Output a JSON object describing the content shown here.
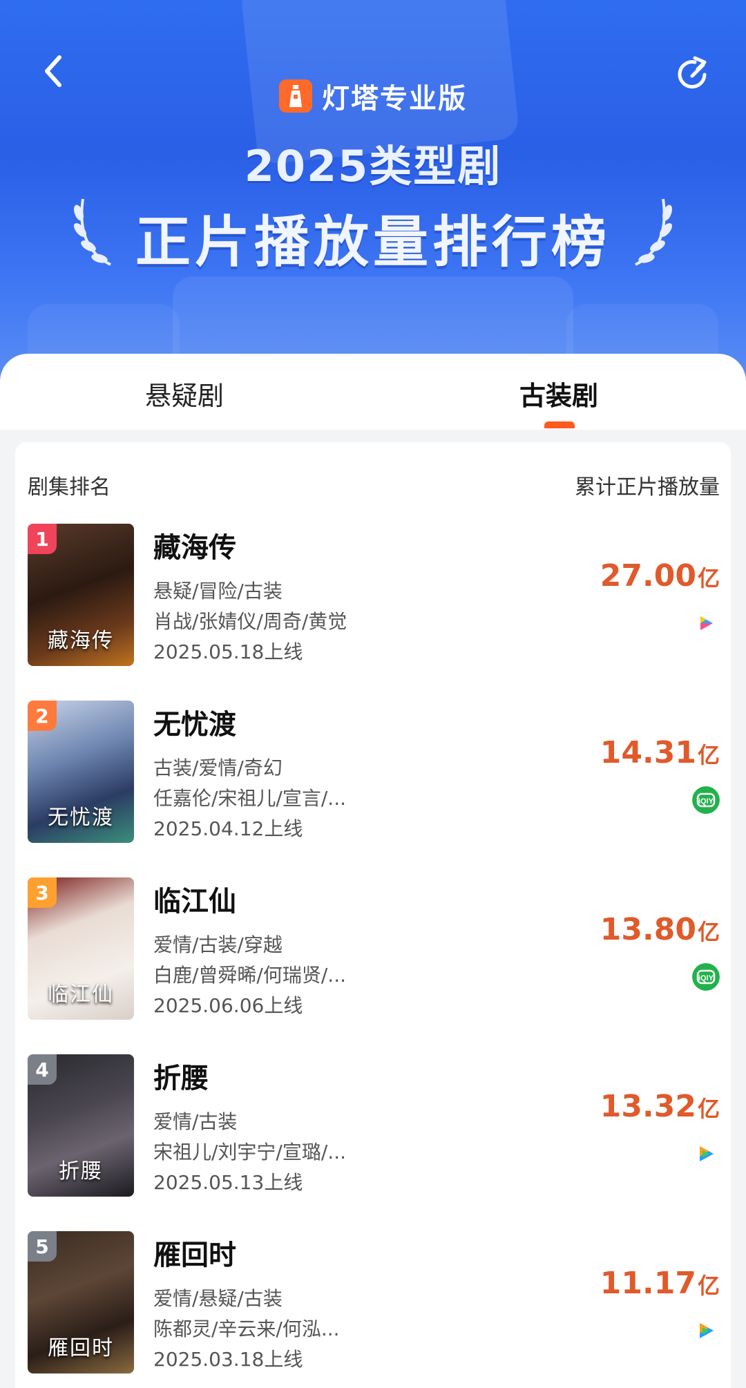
{
  "header": {
    "brand_name": "灯塔专业版",
    "title_line1": "2025类型剧",
    "title_line2": "正片播放量排行榜"
  },
  "tabs": [
    {
      "label": "悬疑剧",
      "active": false
    },
    {
      "label": "古装剧",
      "active": true
    }
  ],
  "list": {
    "col_left": "剧集排名",
    "col_right": "累计正片播放量",
    "items": [
      {
        "rank": "1",
        "title": "藏海传",
        "genre": "悬疑/冒险/古装",
        "cast": "肖战/张婧仪/周奇/黄觉",
        "date": "2025.05.18上线",
        "value": "27.00",
        "unit": "亿",
        "platform": "youku-icon",
        "poster_text": "藏海传"
      },
      {
        "rank": "2",
        "title": "无忧渡",
        "genre": "古装/爱情/奇幻",
        "cast": "任嘉伦/宋祖儿/宣言/...",
        "date": "2025.04.12上线",
        "value": "14.31",
        "unit": "亿",
        "platform": "iqiyi-icon",
        "poster_text": "无忧渡"
      },
      {
        "rank": "3",
        "title": "临江仙",
        "genre": "爱情/古装/穿越",
        "cast": "白鹿/曾舜晞/何瑞贤/...",
        "date": "2025.06.06上线",
        "value": "13.80",
        "unit": "亿",
        "platform": "iqiyi-icon",
        "poster_text": "临江仙"
      },
      {
        "rank": "4",
        "title": "折腰",
        "genre": "爱情/古装",
        "cast": "宋祖儿/刘宇宁/宣璐/...",
        "date": "2025.05.13上线",
        "value": "13.32",
        "unit": "亿",
        "platform": "tencent-video-icon",
        "poster_text": "折腰"
      },
      {
        "rank": "5",
        "title": "雁回时",
        "genre": "爱情/悬疑/古装",
        "cast": "陈都灵/辛云来/何泓...",
        "date": "2025.03.18上线",
        "value": "11.17",
        "unit": "亿",
        "platform": "tencent-video-icon",
        "poster_text": "雁回时"
      }
    ]
  },
  "colors": {
    "accent": "#e05a2b",
    "header_blue": "#2f6df0",
    "rank1": "#f0445a",
    "rank2": "#ff7a3d",
    "rank3": "#ffa030",
    "rank_other": "#7a7f88"
  }
}
